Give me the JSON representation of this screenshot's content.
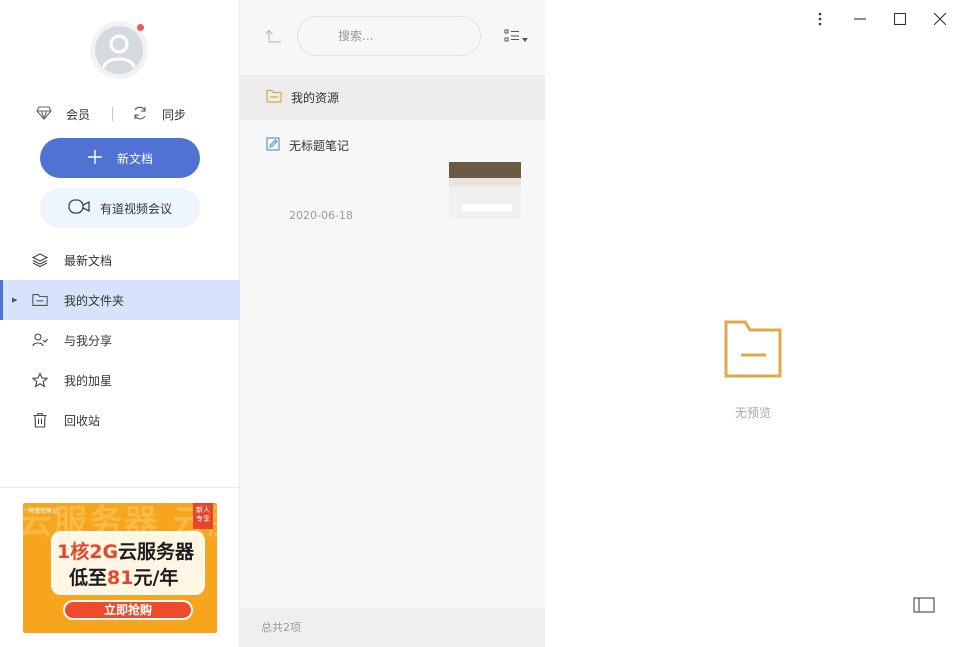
{
  "sidebar": {
    "member_label": "会员",
    "sync_label": "同步",
    "new_doc_label": "新文档",
    "meeting_label": "有道视频会议",
    "nav": [
      {
        "label": "最新文档",
        "icon": "layers-icon"
      },
      {
        "label": "我的文件夹",
        "icon": "folder-icon",
        "active": true
      },
      {
        "label": "与我分享",
        "icon": "shared-users-icon"
      },
      {
        "label": "我的加星",
        "icon": "star-icon"
      },
      {
        "label": "回收站",
        "icon": "trash-icon"
      }
    ],
    "ad": {
      "brand": "有道云笔记",
      "tag": "新人专享",
      "line1_a": "1核2G",
      "line1_b": "云服务器",
      "line2_a": "低至",
      "line2_b": "81",
      "line2_c": "元/年",
      "cta": "立即抢购",
      "bg_text": "云服务器 云服务器"
    }
  },
  "list": {
    "search_placeholder": "搜索...",
    "items": [
      {
        "type": "folder",
        "title": "我的资源"
      },
      {
        "type": "note",
        "title": "无标题笔记",
        "date": "2020-06-18"
      }
    ],
    "footer": "总共2项"
  },
  "preview": {
    "empty_label": "无预览"
  },
  "colors": {
    "accent": "#4f72d3",
    "folder": "#e0a84a",
    "active_bg": "#d7e3fa"
  }
}
